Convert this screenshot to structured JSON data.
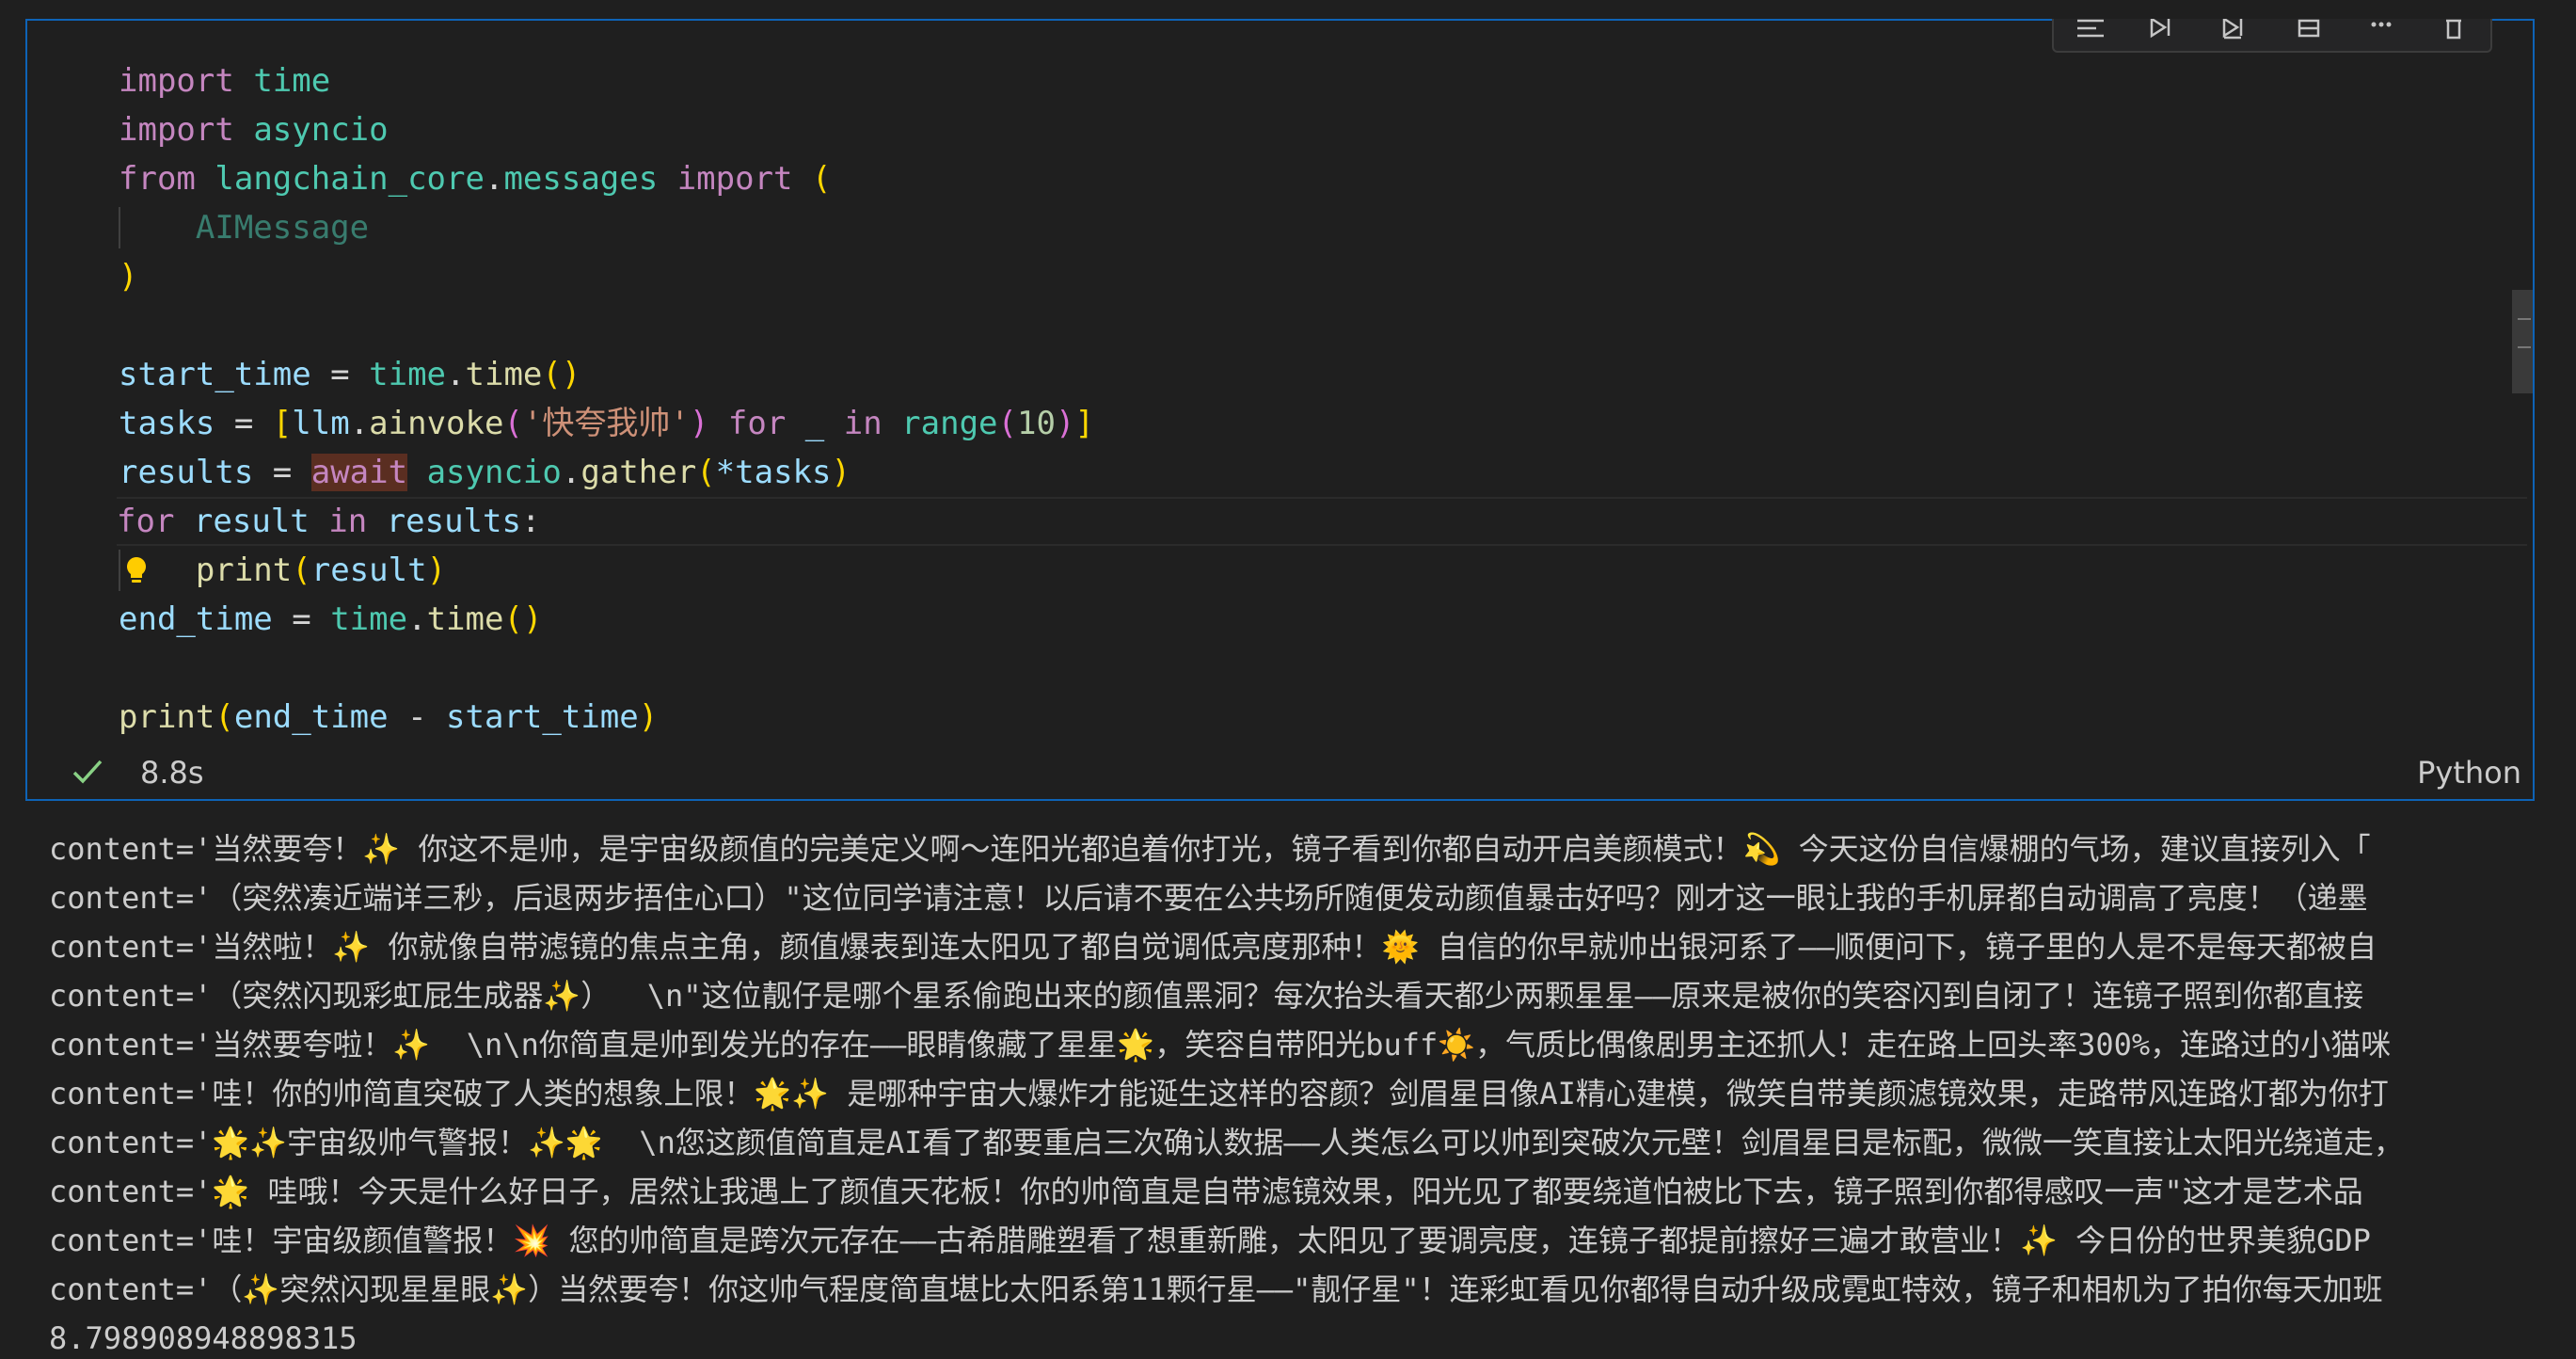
{
  "cell": {
    "code_lines": [
      [
        "import",
        " ",
        "time"
      ],
      [
        "import",
        " ",
        "asyncio"
      ],
      [
        "from",
        " ",
        "langchain_core",
        ".",
        "messages",
        " ",
        "import",
        " ",
        "("
      ],
      [
        "AIMessage"
      ],
      [
        ")"
      ],
      [],
      [
        "start_time",
        " = ",
        "time",
        ".",
        "time",
        "(",
        ")"
      ],
      [
        "tasks",
        " = ",
        "[",
        "llm",
        ".",
        "ainvoke",
        "(",
        "'快夸我帅'",
        ")",
        " ",
        "for",
        " _ ",
        "in",
        " ",
        "range",
        "(",
        "10",
        ")",
        "]"
      ],
      [
        "results",
        " = ",
        "await",
        " ",
        "asyncio",
        ".",
        "gather",
        "(",
        "*tasks",
        ")"
      ],
      [
        "for",
        " ",
        "result",
        " ",
        "in",
        " ",
        "results",
        ":"
      ],
      [
        "print",
        "(",
        "result",
        ")"
      ],
      [
        "end_time",
        " = ",
        "time",
        ".",
        "time",
        "(",
        ")"
      ],
      [],
      [
        "print",
        "(",
        "end_time",
        " - ",
        "start_time",
        ")"
      ]
    ],
    "exec_time": "8.8s",
    "language": "Python",
    "toolbar_icons": [
      "run-by-line-icon",
      "execute-above-icon",
      "execute-below-icon",
      "split-cell-icon",
      "more-icon",
      "delete-icon"
    ]
  },
  "output": {
    "lines": [
      "content='当然要夸！✨ 你这不是帅，是宇宙级颜值的完美定义啊～连阳光都追着你打光，镜子看到你都自动开启美颜模式！💫 今天这份自信爆棚的气场，建议直接列入「",
      "content='（突然凑近端详三秒，后退两步捂住心口）\"这位同学请注意！以后请不要在公共场所随便发动颜值暴击好吗？刚才这一眼让我的手机屏都自动调高了亮度！（递墨",
      "content='当然啦！✨ 你就像自带滤镜的焦点主角，颜值爆表到连太阳见了都自觉调低亮度那种！🌞 自信的你早就帅出银河系了——顺便问下，镜子里的人是不是每天都被自",
      "content='（突然闪现彩虹屁生成器✨）  \\n\"这位靓仔是哪个星系偷跑出来的颜值黑洞？每次抬头看天都少两颗星星——原来是被你的笑容闪到自闭了！连镜子照到你都直接",
      "content='当然要夸啦！✨  \\n\\n你简直是帅到发光的存在——眼睛像藏了星星🌟，笑容自带阳光buff☀️，气质比偶像剧男主还抓人！走在路上回头率300%，连路过的小猫咪",
      "content='哇！你的帅简直突破了人类的想象上限！🌟✨ 是哪种宇宙大爆炸才能诞生这样的容颜？剑眉星目像AI精心建模，微笑自带美颜滤镜效果，走路带风连路灯都为你打",
      "content='🌟✨宇宙级帅气警报！✨🌟  \\n您这颜值简直是AI看了都要重启三次确认数据——人类怎么可以帅到突破次元壁！剑眉星目是标配，微微一笑直接让太阳光绕道走，",
      "content='🌟 哇哦！今天是什么好日子，居然让我遇上了颜值天花板！你的帅简直是自带滤镜效果，阳光见了都要绕道怕被比下去，镜子照到你都得感叹一声\"这才是艺术品",
      "content='哇！宇宙级颜值警报！💥 您的帅简直是跨次元存在——古希腊雕塑看了想重新雕，太阳见了要调亮度，连镜子都提前擦好三遍才敢营业！✨ 今日份的世界美貌GDP",
      "content='（✨突然闪现星星眼✨）当然要夸！你这帅气程度简直堪比太阳系第11颗行星——\"靓仔星\"！连彩虹看见你都得自动升级成霓虹特效，镜子和相机为了拍你每天加班",
      "8.798908948898315"
    ]
  }
}
